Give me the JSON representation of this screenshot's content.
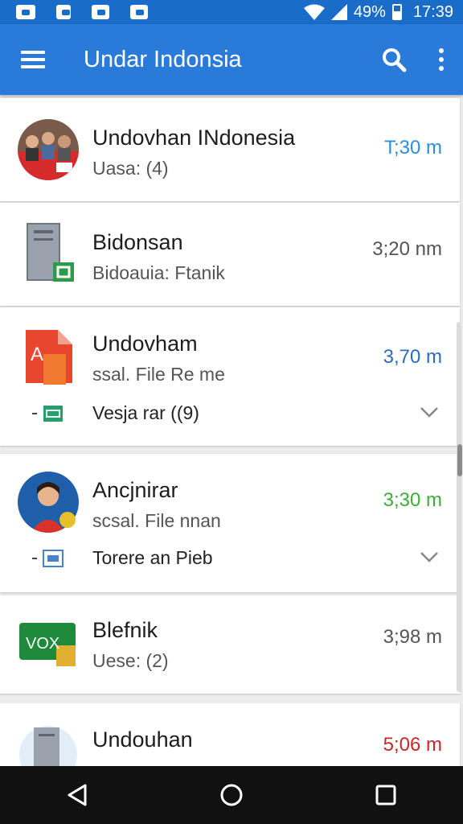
{
  "status_bar": {
    "battery": "49%",
    "time": "17:39",
    "icons": [
      "image-notification-icon",
      "file-notification-icon",
      "sim-notification-icon",
      "calendar-notification-icon",
      "wifi-icon",
      "signal-icon",
      "battery-icon"
    ]
  },
  "app_bar": {
    "title": "Undar Indonsia",
    "icons": [
      "menu-icon",
      "search-icon",
      "more-vert-icon"
    ]
  },
  "colors": {
    "status_bar": "#1a6cc9",
    "app_bar": "#2a7ad9",
    "time_blue": "#2a8fd8",
    "time_dark_blue": "#2a6cc0",
    "time_green": "#3aad3a",
    "time_red": "#c62828",
    "time_gray": "#555555"
  },
  "items": [
    {
      "title": "Undovhan INdonesia",
      "subtitle": "Uasa: (4)",
      "time": "T;30 m",
      "avatar": "group-photo-avatar"
    },
    {
      "title": "Bidonsan",
      "subtitle": "Bidoauia: Ftanik",
      "time": "3;20 nm",
      "avatar": "server-file-icon"
    },
    {
      "title": "Undovham",
      "subtitle": "ssal. File Re me",
      "time": "3,70 m",
      "avatar": "document-a-icon",
      "sub_item": {
        "label": "Vesja rar ((9)",
        "icon": "green-file-icon"
      }
    },
    {
      "title": "Ancjnirar",
      "subtitle": "scsal. File nnan",
      "time": "3;30 m",
      "avatar": "person-photo-avatar",
      "sub_item": {
        "label": "Torere an Pieb",
        "icon": "blue-file-icon"
      }
    },
    {
      "title": "Blefnik",
      "subtitle": "Uese: (2)",
      "time": "3;98 m",
      "avatar": "vox-folder-icon",
      "avatar_label": "VOX"
    },
    {
      "title": "Undouhan",
      "subtitle": "",
      "time": "5;06 m",
      "avatar": "server-file-icon"
    }
  ],
  "nav_bar": {
    "icons": [
      "back-icon",
      "home-icon",
      "recents-icon"
    ]
  }
}
